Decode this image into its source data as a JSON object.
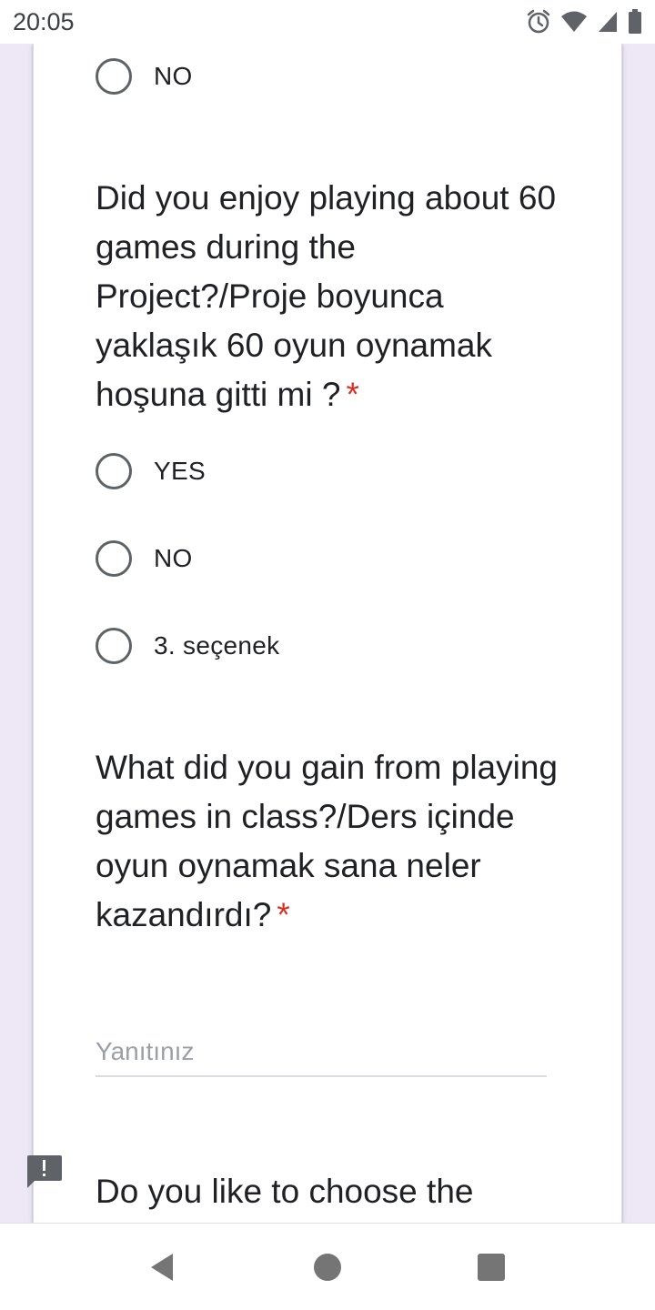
{
  "status_bar": {
    "time": "20:05",
    "icons": [
      "alarm-icon",
      "wifi-icon",
      "signal-icon",
      "battery-icon"
    ]
  },
  "question_prev": {
    "options": [
      {
        "label": "NO",
        "selected": false
      }
    ]
  },
  "question_enjoy": {
    "text": "Did you enjoy playing about 60 games during the Project?/Proje boyunca yaklaşık 60 oyun oynamak hoşuna gitti mi ?",
    "required_mark": "*",
    "options": [
      {
        "label": "YES",
        "selected": false
      },
      {
        "label": "NO",
        "selected": false
      },
      {
        "label": "3. seçenek",
        "selected": false
      }
    ]
  },
  "question_gain": {
    "text": "What did you gain from playing games in class?/Ders içinde oyun oynamak sana neler kazandırdı?",
    "required_mark": "*",
    "answer_value": "",
    "placeholder": "Yanıtınız"
  },
  "question_choose": {
    "text": "Do you like to choose the"
  },
  "colors": {
    "background": "#ede7f6",
    "card": "#ffffff",
    "required": "#d93025",
    "radio_border": "#5f6368"
  },
  "nav_bar": {
    "icons": [
      "back-icon",
      "home-icon",
      "recents-icon"
    ]
  }
}
